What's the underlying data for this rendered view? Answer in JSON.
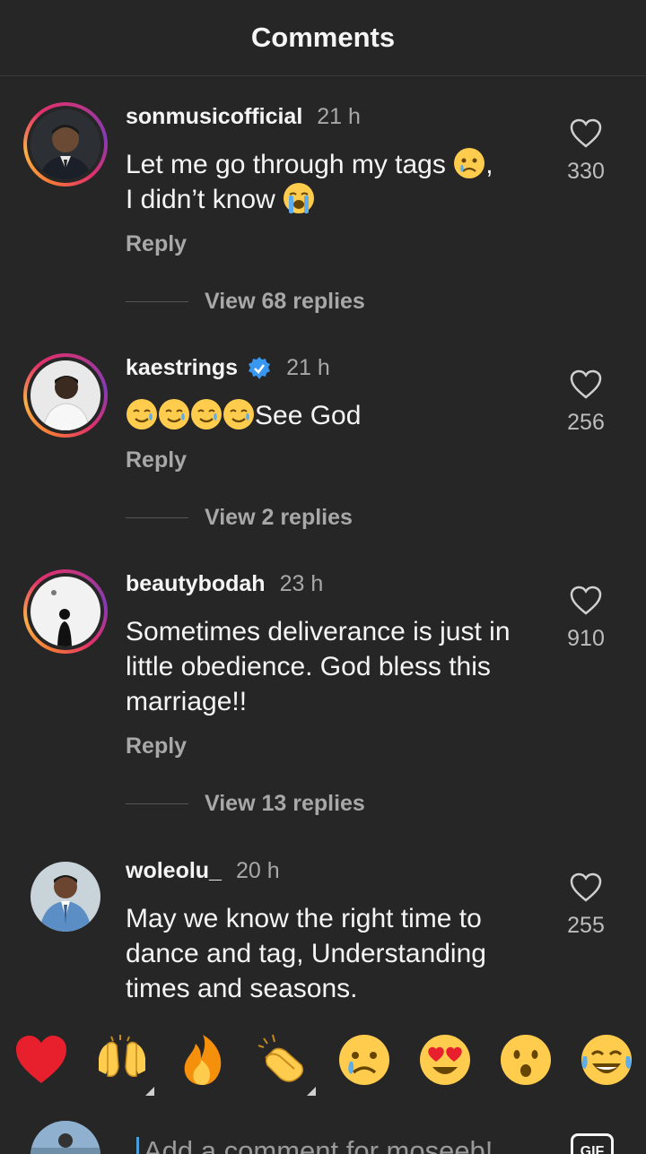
{
  "header": {
    "title": "Comments"
  },
  "comments": [
    {
      "username": "sonmusicofficial",
      "verified": false,
      "time": "21 h",
      "text_lines": [
        "Let me go through my tags",
        "I didn’t know"
      ],
      "reply_label": "Reply",
      "likes": "330",
      "view_replies": "View 68 replies",
      "avatar": "man-in-suit-avatar",
      "story_ring": true
    },
    {
      "username": "kaestrings",
      "verified": true,
      "time": "21 h",
      "text": "See God",
      "reply_label": "Reply",
      "likes": "256",
      "view_replies": "View 2 replies",
      "avatar": "man-white-shirt-avatar",
      "story_ring": true
    },
    {
      "username": "beautybodah",
      "verified": false,
      "time": "23 h",
      "text": "Sometimes deliverance is just in little obedience. God bless this marriage!!",
      "reply_label": "Reply",
      "likes": "910",
      "view_replies": "View 13 replies",
      "avatar": "woman-silhouette-avatar",
      "story_ring": true
    },
    {
      "username": "woleolu_",
      "verified": false,
      "time": "20 h",
      "text": "May we know the right time to dance and tag, Understanding times and seasons.",
      "likes": "255",
      "avatar": "man-blue-suit-avatar",
      "story_ring": false
    }
  ],
  "quick_reactions": [
    "red-heart",
    "raising-hands",
    "fire",
    "clapping-hands",
    "crying-face",
    "heart-eyes-face",
    "surprised-face",
    "tears-of-joy-face"
  ],
  "composer": {
    "placeholder": "Add a comment for moseeb!",
    "gif_label": "GIF"
  },
  "colors": {
    "background": "#262626",
    "text": "#f5f5f5",
    "muted": "#a8a8a8",
    "verified": "#3897f0",
    "heart": "#ed4956"
  }
}
